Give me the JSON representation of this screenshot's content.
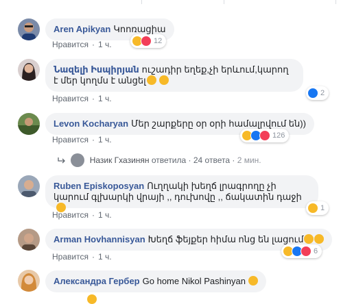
{
  "comments": [
    {
      "author": "Aren Apikyan",
      "text": "Կոոռացիա",
      "like_label": "Нравится",
      "time": "1 ч.",
      "reactions_count": "12"
    },
    {
      "author": "Նազելի Իսպիրյան",
      "text": "ուշադիր եղեք,չի երևում,կարող է մեր կողմս է անցել",
      "like_label": "Нравится",
      "time": "1 ч.",
      "reactions_count": "2"
    },
    {
      "author": "Levon Kocharyan",
      "text": "Մեր շարքերը օր օրի համալրվում են))",
      "like_label": "Нравится",
      "time": "1 ч.",
      "reactions_count": "126"
    },
    {
      "author": "Ruben Episkoposyan",
      "text": "Ուղղակի խեղճ լրագրողը չի կարում գլխարկի վրայի ,, դուխովը ,, ճակատին դաջի",
      "like_label": "Нравится",
      "time": "1 ч.",
      "reactions_count": "1"
    },
    {
      "author": "Arman Hovhannisyan",
      "text": "Խեղճ ֆեյքեր հիմա ոնց են լացում",
      "like_label": "Нравится",
      "time": "1 ч.",
      "reactions_count": "6"
    },
    {
      "author": "Александра Гербер",
      "text": "Go home Nikol Pashinyan"
    }
  ],
  "reply_summary": {
    "author": "Назик Гхазинян",
    "verb": "ответила",
    "count_text": "24 ответа",
    "time": "2 мин."
  },
  "colors": {
    "author_link": "#385898",
    "bubble_bg": "#f2f3f5",
    "meta_text": "#606770",
    "like_blue": "#1877f2",
    "love_red": "#f33e58",
    "haha_yellow": "#f7b928"
  },
  "icons": {
    "like": "thumbs-up-icon",
    "love": "heart-icon",
    "haha": "laughing-face-icon",
    "smile": "smiling-face-icon",
    "tongue": "tongue-face-icon",
    "worried": "worried-face-icon",
    "reply_arrow": "reply-arrow-icon"
  }
}
